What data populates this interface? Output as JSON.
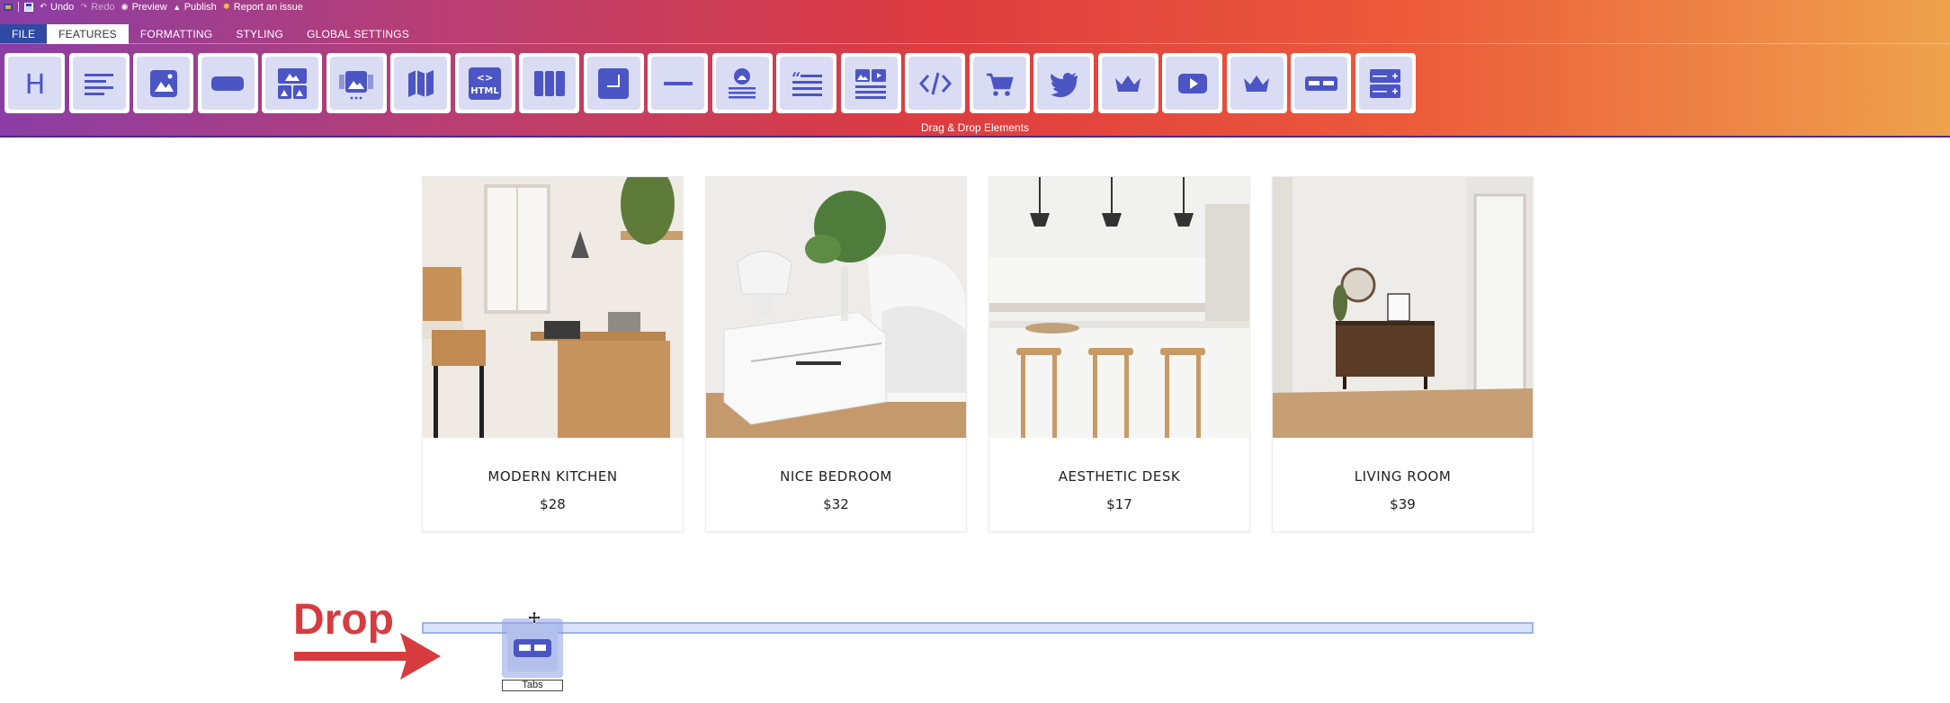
{
  "menu": {
    "undo": "Undo",
    "redo": "Redo",
    "preview": "Preview",
    "publish": "Publish",
    "report": "Report an issue"
  },
  "tabs": [
    "FILE",
    "FEATURES",
    "FORMATTING",
    "STYLING",
    "GLOBAL SETTINGS"
  ],
  "toolbar": {
    "tools": [
      {
        "name": "heading-tool",
        "icon": "heading-icon"
      },
      {
        "name": "text-tool",
        "icon": "text-lines-icon"
      },
      {
        "name": "image-tool",
        "icon": "image-icon"
      },
      {
        "name": "button-tool",
        "icon": "button-icon"
      },
      {
        "name": "image-grid-tool",
        "icon": "image-grid-icon"
      },
      {
        "name": "image-slider-tool",
        "icon": "image-slider-icon"
      },
      {
        "name": "map-tool",
        "icon": "map-icon"
      },
      {
        "name": "html-tool",
        "icon": "html-icon"
      },
      {
        "name": "columns-tool",
        "icon": "columns-icon"
      },
      {
        "name": "container-tool",
        "icon": "container-icon"
      },
      {
        "name": "divider-tool",
        "icon": "divider-icon"
      },
      {
        "name": "testimonial-tool",
        "icon": "profile-icon"
      },
      {
        "name": "quote-tool",
        "icon": "quote-icon"
      },
      {
        "name": "media-text-tool",
        "icon": "media-text-icon"
      },
      {
        "name": "embed-code-tool",
        "icon": "code-icon"
      },
      {
        "name": "cart-tool",
        "icon": "cart-icon"
      },
      {
        "name": "twitter-tool",
        "icon": "twitter-icon"
      },
      {
        "name": "pricing-tool",
        "icon": "crown-icon"
      },
      {
        "name": "youtube-tool",
        "icon": "youtube-icon"
      },
      {
        "name": "premium-tool",
        "icon": "crown-icon"
      },
      {
        "name": "tabs-tool",
        "icon": "tabs-icon"
      },
      {
        "name": "accordion-tool",
        "icon": "accordion-icon"
      }
    ],
    "caption": "Drag & Drop Elements"
  },
  "products": [
    {
      "name": "MODERN KITCHEN",
      "price": "$28"
    },
    {
      "name": "NICE BEDROOM",
      "price": "$32"
    },
    {
      "name": "AESTHETIC DESK",
      "price": "$17"
    },
    {
      "name": "LIVING ROOM",
      "price": "$39"
    }
  ],
  "drop": {
    "label": "Drop",
    "dragged_label": "Tabs"
  },
  "colors": {
    "icon": "#4b55c4",
    "tool_bg": "#d9dcf3",
    "drop_red": "#d63c3f",
    "file_tab": "#2f4aa3"
  }
}
